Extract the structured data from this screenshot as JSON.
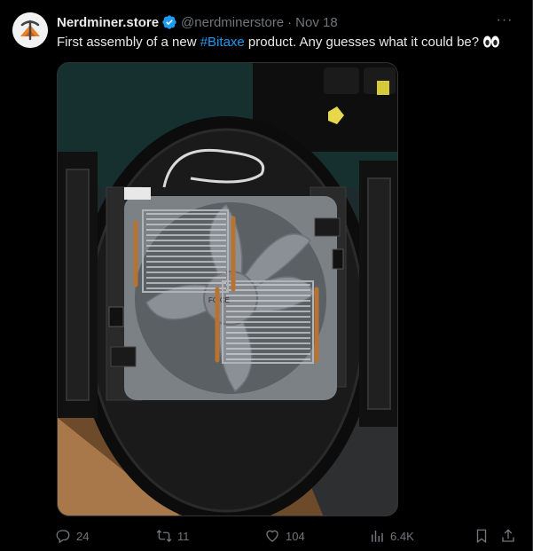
{
  "tweet": {
    "display_name": "Nerdminer.store",
    "handle": "@nerdminerstore",
    "separator": "·",
    "date": "Nov 18",
    "more_label": "···",
    "text_before": "First assembly of a new ",
    "hashtag": "#Bitaxe",
    "text_after": " product. Any guesses what it could be?",
    "emoji_icon": "eyes-emoji",
    "media_icon": "photo-of-fan-and-heatsinks"
  },
  "actions": {
    "replies": "24",
    "reposts": "11",
    "likes": "104",
    "views": "6.4K"
  },
  "colors": {
    "background": "#000000",
    "text": "#e7e9ea",
    "muted": "#71767b",
    "link": "#1d9bf0",
    "verified": "#1d9bf0"
  }
}
